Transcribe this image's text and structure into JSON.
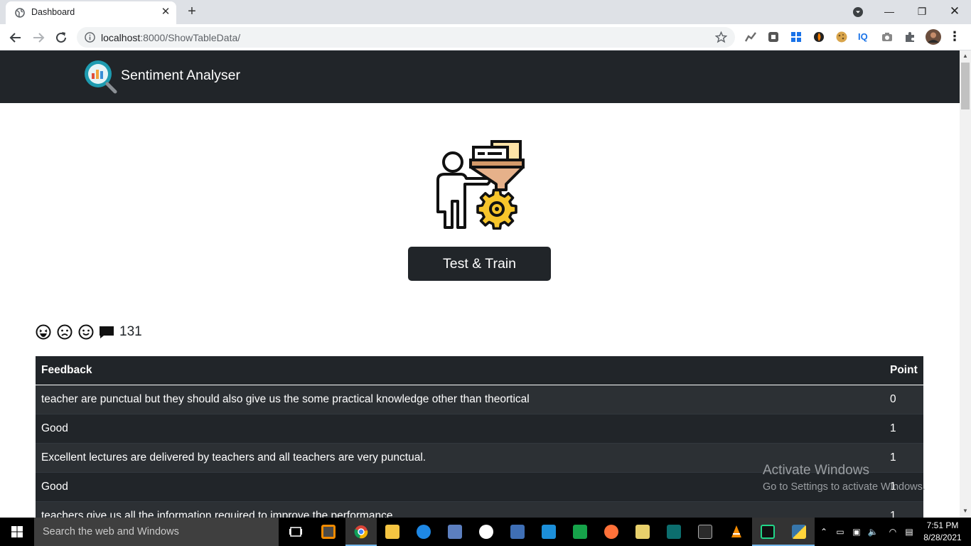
{
  "browser": {
    "tab_title": "Dashboard",
    "url_host": "localhost",
    "url_rest": ":8000/ShowTableData/"
  },
  "navbar": {
    "brand": "Sentiment Analyser"
  },
  "main": {
    "train_button": "Test & Train",
    "stats_count": "131"
  },
  "table": {
    "headers": [
      "Feedback",
      "Point"
    ],
    "rows": [
      {
        "feedback": "teacher are punctual but they should also give us the some practical knowledge other than theortical",
        "point": "0"
      },
      {
        "feedback": "Good",
        "point": "1"
      },
      {
        "feedback": "Excellent lectures are delivered by teachers and all teachers are very punctual.",
        "point": "1"
      },
      {
        "feedback": "Good",
        "point": "1"
      },
      {
        "feedback": "teachers give us all the information required to improve the performance",
        "point": "1"
      }
    ]
  },
  "watermark": {
    "line1": "Activate Windows",
    "line2": "Go to Settings to activate Windows."
  },
  "taskbar": {
    "search_placeholder": "Search the web and Windows",
    "time": "7:51 PM",
    "date": "8/28/2021"
  },
  "colors": {
    "navbar_bg": "#212529",
    "table_odd": "#2c3034",
    "table_even": "#212529",
    "tab_strip": "#dee1e6"
  },
  "icons": {
    "stats": [
      "laughing-face-icon",
      "frowning-face-icon",
      "smiling-face-icon",
      "comment-icon"
    ]
  }
}
